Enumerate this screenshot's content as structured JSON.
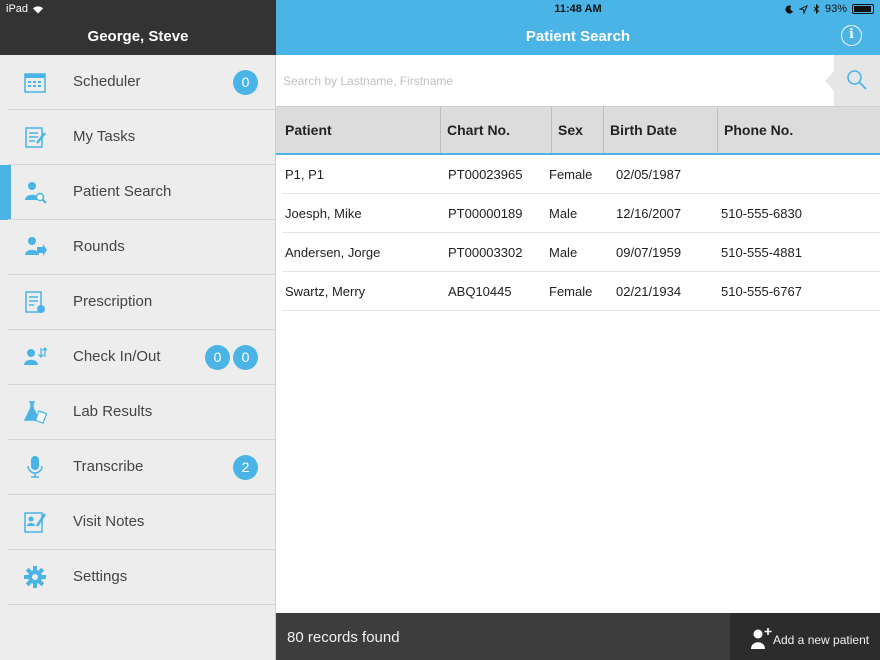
{
  "status_bar": {
    "device": "iPad",
    "time": "11:48 AM",
    "battery": "93%"
  },
  "sidebar": {
    "user_name": "George, Steve",
    "items": [
      {
        "label": "Scheduler",
        "icon": "calendar-icon",
        "badges": [
          "0"
        ]
      },
      {
        "label": "My Tasks",
        "icon": "tasks-icon",
        "badges": []
      },
      {
        "label": "Patient Search",
        "icon": "patient-search-icon",
        "badges": [],
        "active": true
      },
      {
        "label": "Rounds",
        "icon": "rounds-icon",
        "badges": []
      },
      {
        "label": "Prescription",
        "icon": "prescription-icon",
        "badges": []
      },
      {
        "label": "Check In/Out",
        "icon": "check-in-out-icon",
        "badges": [
          "0",
          "0"
        ]
      },
      {
        "label": "Lab Results",
        "icon": "lab-flask-icon",
        "badges": []
      },
      {
        "label": "Transcribe",
        "icon": "microphone-icon",
        "badges": [
          "2"
        ]
      },
      {
        "label": "Visit Notes",
        "icon": "visit-notes-icon",
        "badges": []
      },
      {
        "label": "Settings",
        "icon": "gear-icon",
        "badges": []
      }
    ]
  },
  "main": {
    "title": "Patient Search",
    "search": {
      "placeholder": "Search by Lastname, Firstname",
      "value": ""
    },
    "table": {
      "columns": [
        "Patient",
        "Chart No.",
        "Sex",
        "Birth Date",
        "Phone No."
      ],
      "rows": [
        [
          "P1, P1",
          "PT00023965",
          "Female",
          "02/05/1987",
          ""
        ],
        [
          "Joesph, Mike",
          "PT00000189",
          "Male",
          "12/16/2007",
          "510-555-6830"
        ],
        [
          "Andersen, Jorge",
          "PT00003302",
          "Male",
          "09/07/1959",
          "510-555-4881"
        ],
        [
          "Swartz, Merry",
          "ABQ10445",
          "Female",
          "02/21/1934",
          "510-555-6767"
        ]
      ]
    },
    "footer": {
      "records": "80 records found",
      "add_label": "Add a new patient"
    }
  },
  "colors": {
    "accent": "#4ab4e6",
    "dark": "#333333",
    "sidebar_bg": "#ededed"
  }
}
